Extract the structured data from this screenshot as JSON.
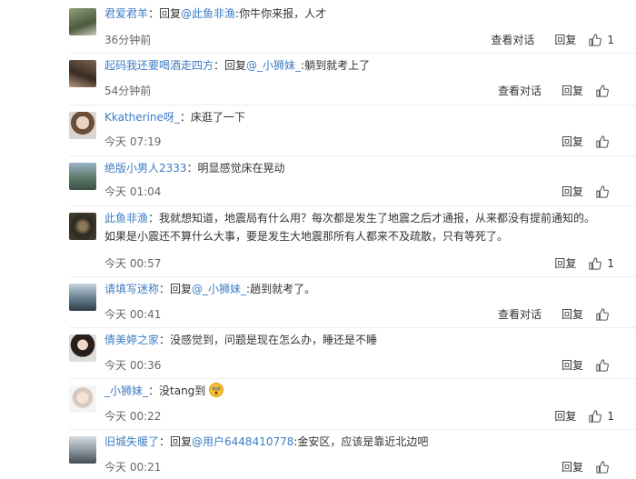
{
  "actions": {
    "view_conversation": "查看对话",
    "reply": "回复"
  },
  "comments": [
    {
      "user": "君爱君羊",
      "prefix": "：回复",
      "mention": "@此鱼非渔",
      "text": ":你牛你来报，人才",
      "time": "36分钟前",
      "view": true,
      "likes": "1"
    },
    {
      "user": "起码我还要喝酒走四方",
      "prefix": "：回复",
      "mention": "@_小狮妹_",
      "text": ":躺到就考上了",
      "time": "54分钟前",
      "view": true,
      "likes": ""
    },
    {
      "user": "Kkatherine呀_",
      "prefix": "：床逛了一下",
      "mention": "",
      "text": "",
      "time": "今天 07:19",
      "view": false,
      "likes": ""
    },
    {
      "user": "绝版小男人2333",
      "prefix": "：明显感觉床在晃动",
      "mention": "",
      "text": "",
      "time": "今天 01:04",
      "view": false,
      "likes": ""
    },
    {
      "user": "此鱼非渔",
      "prefix": "：我就想知道，地震局有什么用？每次都是发生了地震之后才通报，从来都没有提前通知的。如果是小震还不算什么大事，要是发生大地震那所有人都来不及疏散，只有等死了。",
      "mention": "",
      "text": "",
      "time": "今天 00:57",
      "view": false,
      "likes": "1"
    },
    {
      "user": "请填写迷称",
      "prefix": "：回复",
      "mention": "@_小狮妹_",
      "text": ":趟到就考了。",
      "time": "今天 00:41",
      "view": true,
      "likes": ""
    },
    {
      "user": "倩美婷之家",
      "prefix": "：没感觉到，问题是现在怎么办，睡还是不睡",
      "mention": "",
      "text": "",
      "time": "今天 00:36",
      "view": false,
      "likes": ""
    },
    {
      "user": "_小狮妹_",
      "prefix": "：没tang到",
      "mention": "",
      "text": "",
      "time": "今天 00:22",
      "view": false,
      "likes": "1",
      "emoji": true
    },
    {
      "user": "旧城失暖了",
      "prefix": "：回复",
      "mention": "@用户6448410778",
      "text": ":金安区，应该是靠近北边吧",
      "time": "今天 00:21",
      "view": false,
      "likes": ""
    }
  ],
  "colors": {
    "link": "#3d7cc4",
    "text": "#333333",
    "time": "#666666",
    "divider": "#eeeeee"
  },
  "icons": {
    "like": "thumbs-up-icon"
  }
}
